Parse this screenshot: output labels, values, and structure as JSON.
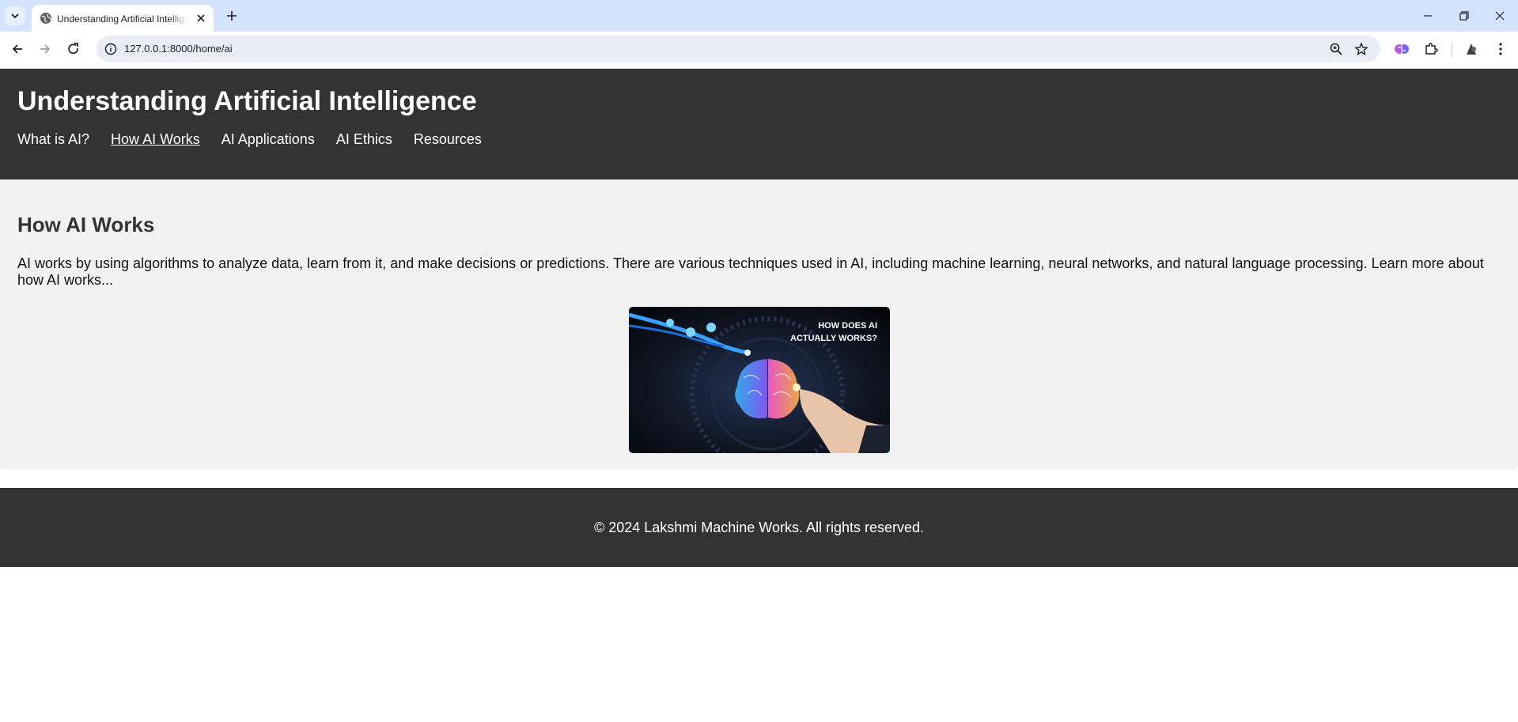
{
  "browser": {
    "tab_title": "Understanding Artificial Intelligence",
    "url": "127.0.0.1:8000/home/ai"
  },
  "site": {
    "title": "Understanding Artificial Intelligence",
    "nav": [
      {
        "label": "What is AI?",
        "active": false
      },
      {
        "label": "How AI Works",
        "active": true
      },
      {
        "label": "AI Applications",
        "active": false
      },
      {
        "label": "AI Ethics",
        "active": false
      },
      {
        "label": "Resources",
        "active": false
      }
    ]
  },
  "main": {
    "heading": "How AI Works",
    "paragraph": "AI works by using algorithms to analyze data, learn from it, and make decisions or predictions. There are various techniques used in AI, including machine learning, neural networks, and natural language processing. Learn more about how AI works...",
    "image_caption": "HOW DOES AI\nACTUALLY WORKS?"
  },
  "footer": {
    "text": "© 2024 Lakshmi Machine Works. All rights reserved."
  },
  "colors": {
    "header_bg": "#333333",
    "main_bg": "#f2f2f2",
    "tabbar_bg": "#d3e3fd"
  }
}
